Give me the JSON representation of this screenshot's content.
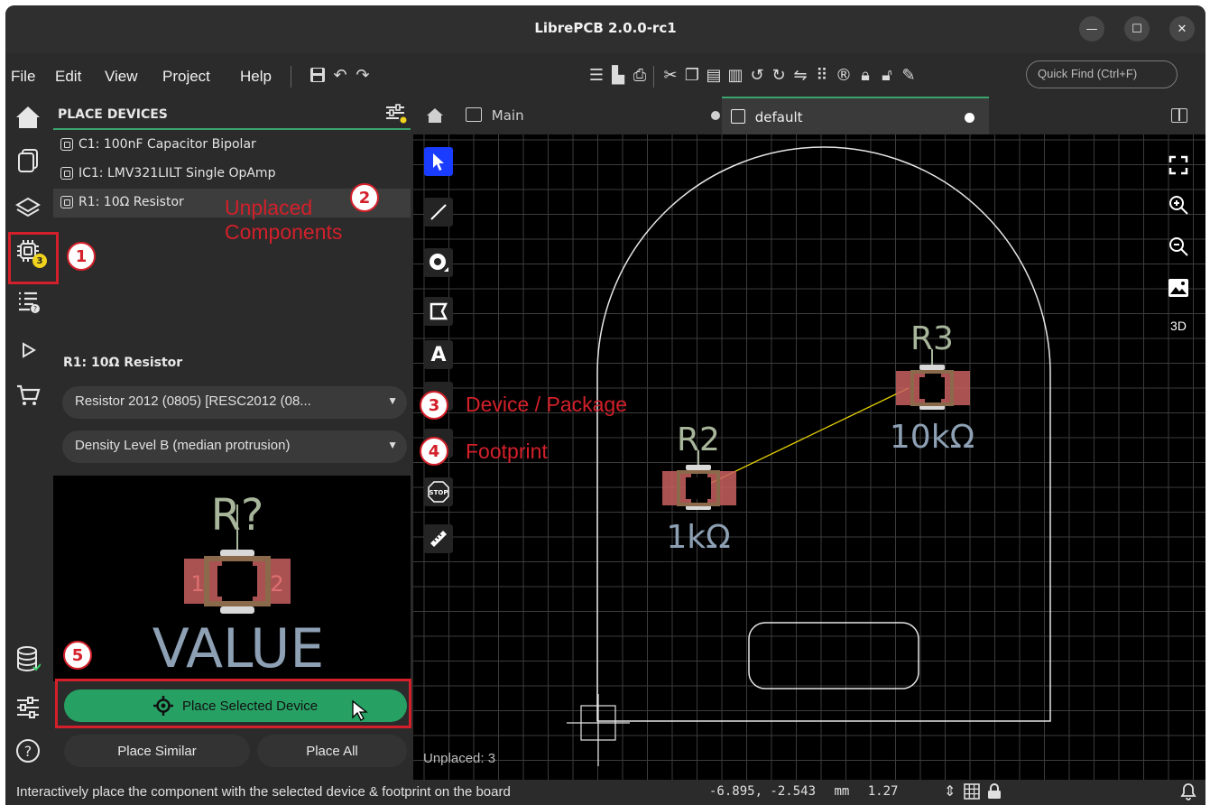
{
  "window": {
    "title": "LibrePCB 2.0.0-rc1"
  },
  "menu": {
    "items": [
      "File",
      "Edit",
      "View",
      "Project",
      "Help"
    ]
  },
  "quick_find": {
    "placeholder": "Quick Find (Ctrl+F)"
  },
  "sidebar": {
    "badge_count": "3"
  },
  "panel": {
    "title": "PLACE DEVICES",
    "components": [
      "C1: 100nF Capacitor Bipolar",
      "IC1: LMV321LILT Single OpAmp",
      "R1: 10Ω Resistor"
    ],
    "selected_title": "R1: 10Ω Resistor",
    "device_select": "Resistor 2012 (0805) [RESC2012 (08...",
    "footprint_select": "Density Level B (median protrusion)",
    "preview": {
      "name": "R?",
      "value": "VALUE",
      "pad1": "1",
      "pad2": "2"
    },
    "place_selected_label": "Place Selected Device",
    "place_similar_label": "Place Similar",
    "place_all_label": "Place All"
  },
  "tabs": [
    {
      "label": "Main"
    },
    {
      "label": "default"
    }
  ],
  "board": {
    "parts": [
      {
        "name": "R2",
        "value": "1kΩ"
      },
      {
        "name": "R3",
        "value": "10kΩ"
      }
    ],
    "unplaced_label": "Unplaced: 3",
    "view_3d_label": "3D"
  },
  "annotations": [
    {
      "number": "1",
      "text": ""
    },
    {
      "number": "2",
      "text": "Unplaced Components"
    },
    {
      "number": "3",
      "text": "Device / Package"
    },
    {
      "number": "4",
      "text": "Footprint"
    },
    {
      "number": "5",
      "text": ""
    }
  ],
  "status": {
    "message": "Interactively place the component with the selected device & footprint on the board",
    "coordinates": "-6.895,  -2.543",
    "unit": "mm",
    "grid": "1.27"
  },
  "colors": {
    "accent_green": "#27a064",
    "annotation_red": "#d3202a",
    "badge_yellow": "#f1d21c",
    "active_tool_blue": "#1a3cff",
    "silkscreen": "#a7b59a",
    "value_text": "#8da0b4",
    "copper_pad": "#c86060",
    "ratsnest": "#e5d000"
  }
}
